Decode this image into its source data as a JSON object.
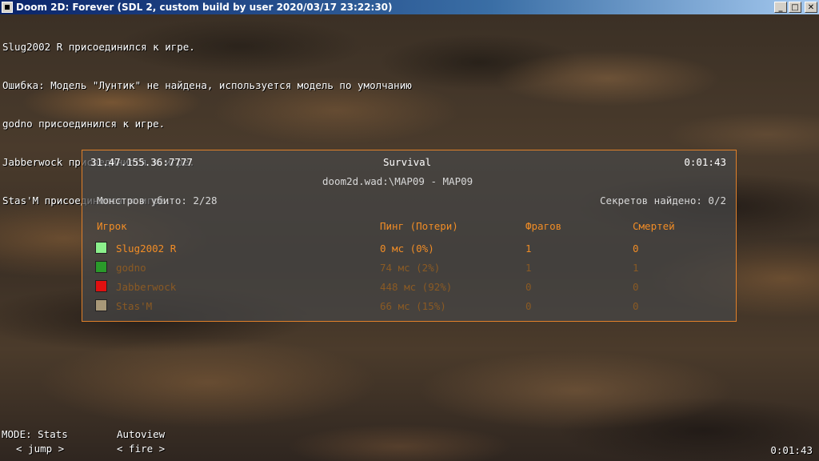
{
  "window": {
    "title": "Doom 2D: Forever (SDL 2, custom build by user 2020/03/17 23:22:30)",
    "buttons": {
      "minimize": "_",
      "maximize": "□",
      "close": "✕"
    }
  },
  "console": {
    "lines": [
      "Slug2002 R присоединился к игре.",
      "Ошибка: Модель \"Лунтик\" не найдена, используется модель по умолчанию",
      "godno присоединился к игре.",
      "Jabberwock присоединился к игре.",
      "Stas'M присоединился к игре."
    ]
  },
  "scoreboard": {
    "server": "31.47.155.36:7777",
    "mode": "Survival",
    "time": "0:01:43",
    "map": "doom2d.wad:\\MAP09 - MAP09",
    "monsters": "Монстров убито: 2/28",
    "secrets": "Секретов найдено: 0/2",
    "headers": {
      "player": "Игрок",
      "ping": "Пинг (Потери)",
      "frags": "Фрагов",
      "deaths": "Смертей"
    },
    "players": [
      {
        "name": "Slug2002 R",
        "ping": "0 мс (0%)",
        "frags": "1",
        "deaths": "0",
        "color": "#8cf08c",
        "active": true
      },
      {
        "name": "godno",
        "ping": "74 мс (2%)",
        "frags": "1",
        "deaths": "1",
        "color": "#2a9a2a",
        "active": false
      },
      {
        "name": "Jabberwock",
        "ping": "448 мс (92%)",
        "frags": "0",
        "deaths": "0",
        "color": "#e01010",
        "active": false
      },
      {
        "name": "Stas'M",
        "ping": "66 мс (15%)",
        "frags": "0",
        "deaths": "0",
        "color": "#a89878",
        "active": false
      }
    ]
  },
  "hud": {
    "mode_label": "MODE: Stats",
    "jump_label": "< jump >",
    "autoview_label": "Autoview",
    "fire_label": "< fire >",
    "clock": "0:01:43"
  }
}
